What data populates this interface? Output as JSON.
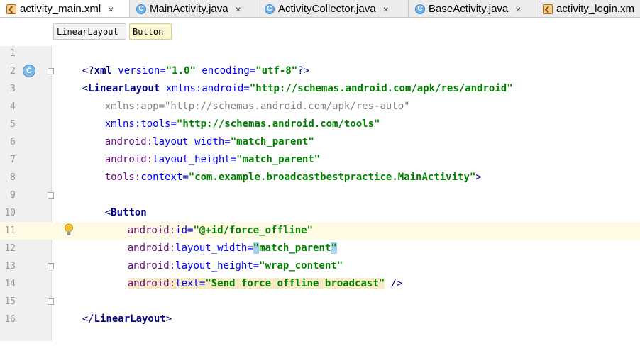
{
  "tabs": [
    {
      "label": "activity_main.xml",
      "icon": "xml-file-icon",
      "active": true
    },
    {
      "label": "MainActivity.java",
      "icon": "java-class-icon",
      "active": false
    },
    {
      "label": "ActivityCollector.java",
      "icon": "java-class-icon",
      "active": false
    },
    {
      "label": "BaseActivity.java",
      "icon": "java-class-icon",
      "active": false
    },
    {
      "label": "activity_login.xm",
      "icon": "xml-file-icon",
      "active": false
    }
  ],
  "close_glyph": "×",
  "class_icon_glyph": "C",
  "breadcrumbs": [
    "LinearLayout",
    "Button"
  ],
  "lines": [
    {
      "n": "1"
    },
    {
      "n": "2"
    },
    {
      "n": "3"
    },
    {
      "n": "4"
    },
    {
      "n": "5"
    },
    {
      "n": "6"
    },
    {
      "n": "7"
    },
    {
      "n": "8"
    },
    {
      "n": "9"
    },
    {
      "n": "10"
    },
    {
      "n": "11"
    },
    {
      "n": "12"
    },
    {
      "n": "13"
    },
    {
      "n": "14"
    },
    {
      "n": "15"
    },
    {
      "n": "16"
    }
  ],
  "code": {
    "l1": {
      "a": "<?",
      "b": "xml",
      "c": " version=",
      "d": "\"1.0\"",
      "e": " encoding=",
      "f": "\"utf-8\"",
      "g": "?>"
    },
    "l2": {
      "a": "<",
      "b": "LinearLayout",
      "c": " xmlns:",
      "d": "android",
      "e": "=",
      "f": "\"http://schemas.android.com/apk/res/android\""
    },
    "l3": {
      "a": "xmlns:app=\"http://schemas.android.com/apk/res-auto\""
    },
    "l4": {
      "a": "xmlns:",
      "b": "tools",
      "c": "=",
      "d": "\"http://schemas.android.com/tools\""
    },
    "l5": {
      "a": "android:",
      "b": "layout_width",
      "c": "=",
      "d": "\"match_parent\""
    },
    "l6": {
      "a": "android:",
      "b": "layout_height",
      "c": "=",
      "d": "\"match_parent\""
    },
    "l7": {
      "a": "tools:",
      "b": "context",
      "c": "=",
      "d": "\"com.example.broadcastbestpractice.MainActivity\"",
      "e": ">"
    },
    "l9": {
      "a": "<",
      "b": "Button"
    },
    "l10": {
      "a": "android:",
      "b": "id",
      "c": "=",
      "d": "\"@+id/force_offline\""
    },
    "l11": {
      "a": "android:",
      "b": "layout_width",
      "c": "=",
      "q1": "\"",
      "d": "match_parent",
      "q2": "\""
    },
    "l12": {
      "a": "android:",
      "b": "layout_height",
      "c": "=",
      "d": "\"wrap_content\""
    },
    "l13": {
      "a": "android:",
      "b": "text",
      "c": "=",
      "d": "\"Send force offline broadcast\"",
      "e": " />"
    },
    "l15": {
      "a": "</",
      "b": "LinearLayout",
      "c": ">"
    }
  },
  "colors": {
    "tag": "#000080",
    "attribute": "#0000ff",
    "namespace": "#660e7a",
    "string": "#008000",
    "current_line": "#fffae3"
  }
}
